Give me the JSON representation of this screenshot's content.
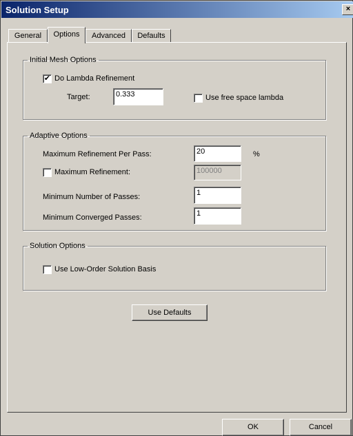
{
  "window": {
    "title": "Solution Setup",
    "close_glyph": "×"
  },
  "tabs": [
    {
      "label": "General",
      "active": false
    },
    {
      "label": "Options",
      "active": true
    },
    {
      "label": "Advanced",
      "active": false
    },
    {
      "label": "Defaults",
      "active": false
    }
  ],
  "initial_mesh": {
    "legend": "Initial Mesh Options",
    "do_lambda": {
      "label": "Do Lambda Refinement",
      "checked": true,
      "mark": "✔"
    },
    "target": {
      "label": "Target:",
      "value": "0.333"
    },
    "free_space": {
      "label": "Use free space lambda",
      "checked": false
    }
  },
  "adaptive": {
    "legend": "Adaptive Options",
    "max_per_pass": {
      "label": "Maximum Refinement Per Pass:",
      "value": "20",
      "unit": "%"
    },
    "max_refinement": {
      "label": "Maximum Refinement:",
      "checked": false,
      "value": "100000"
    },
    "min_passes": {
      "label": "Minimum Number of Passes:",
      "value": "1"
    },
    "min_converged": {
      "label": "Minimum Converged Passes:",
      "value": "1"
    }
  },
  "solution": {
    "legend": "Solution Options",
    "low_order": {
      "label": "Use Low-Order Solution Basis",
      "checked": false
    }
  },
  "buttons": {
    "use_defaults": "Use Defaults",
    "ok": "OK",
    "cancel": "Cancel"
  }
}
